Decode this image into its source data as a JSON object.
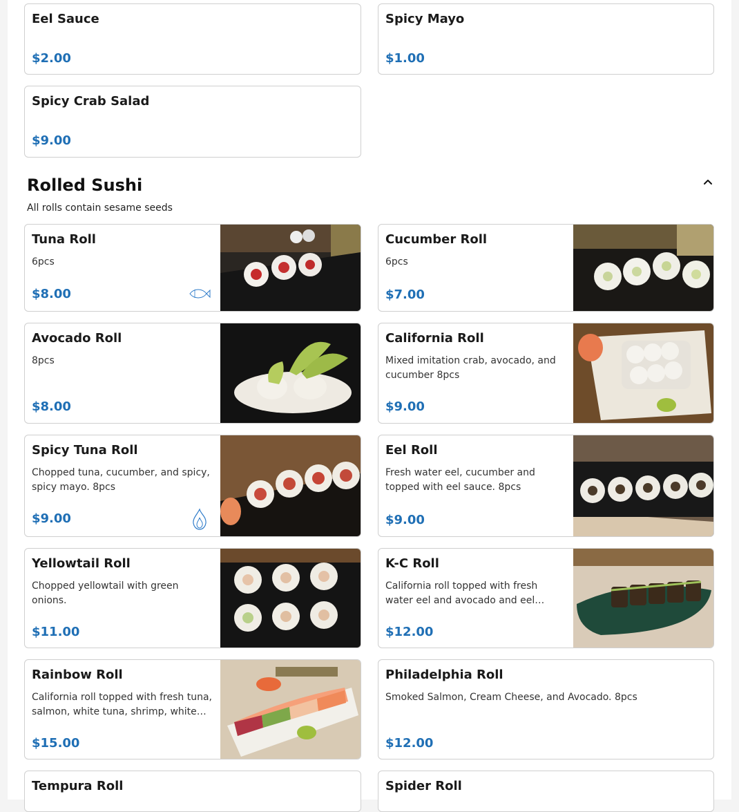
{
  "top_items": [
    {
      "name": "Eel Sauce",
      "price": "$2.00"
    },
    {
      "name": "Spicy Mayo",
      "price": "$1.00"
    },
    {
      "name": "Spicy Crab Salad",
      "price": "$9.00"
    }
  ],
  "section": {
    "title": "Rolled Sushi",
    "note": "All rolls contain sesame seeds",
    "collapse_icon": "chevron-up-icon"
  },
  "items": [
    {
      "name": "Tuna Roll",
      "desc": "6pcs",
      "price": "$8.00",
      "icon": "fish-icon"
    },
    {
      "name": "Cucumber Roll",
      "desc": "6pcs",
      "price": "$7.00"
    },
    {
      "name": "Avocado Roll",
      "desc": "8pcs",
      "price": "$8.00"
    },
    {
      "name": "California Roll",
      "desc": "Mixed imitation crab, avocado, and cucumber 8pcs",
      "price": "$9.00"
    },
    {
      "name": "Spicy Tuna Roll",
      "desc": "Chopped tuna, cucumber, and spicy, spicy mayo. 8pcs",
      "price": "$9.00",
      "icon": "flame-icon"
    },
    {
      "name": "Eel Roll",
      "desc": "Fresh water eel, cucumber and topped with eel sauce. 8pcs",
      "price": "$9.00"
    },
    {
      "name": "Yellowtail Roll",
      "desc": "Chopped yellowtail with green onions.",
      "price": "$11.00"
    },
    {
      "name": "K-C Roll",
      "desc": "California roll topped with fresh water eel and avocado and eel…",
      "price": "$12.00"
    },
    {
      "name": "Rainbow Roll",
      "desc": "California roll topped with fresh tuna, salmon, white tuna, shrimp, white…",
      "price": "$15.00"
    },
    {
      "name": "Philadelphia Roll",
      "desc": "Smoked Salmon, Cream Cheese, and Avocado. 8pcs",
      "price": "$12.00"
    },
    {
      "name": "Tempura Roll"
    },
    {
      "name": "Spider Roll"
    }
  ],
  "colors": {
    "price": "#1f6fb5",
    "border": "#cfcfcf",
    "icon": "#2c7ac9"
  }
}
